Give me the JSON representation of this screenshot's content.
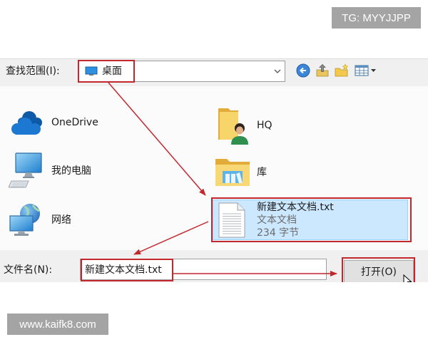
{
  "watermarks": {
    "top_right": "TG: MYYJJPP",
    "bottom_left": "www.kaifk8.com"
  },
  "dialog": {
    "look_in": {
      "label": "查找范围(I):",
      "value": "桌面",
      "icon": "desktop-icon",
      "dropdown_icon": "chevron-down-icon"
    },
    "toolbar": {
      "back": "back-icon",
      "up": "up-one-level-icon",
      "new_folder": "new-folder-icon",
      "view": "view-menu-icon"
    },
    "locations": [
      {
        "label": "OneDrive",
        "icon": "onedrive-cloud-icon"
      },
      {
        "label": "我的电脑",
        "icon": "computer-icon"
      },
      {
        "label": "网络",
        "icon": "network-icon"
      },
      {
        "label": "HQ",
        "icon": "user-folder-icon"
      },
      {
        "label": "库",
        "icon": "library-icon"
      }
    ],
    "selected_file": {
      "name": "新建文本文档.txt",
      "type": "文本文档",
      "size": "234 字节",
      "icon": "text-file-icon"
    },
    "file_name": {
      "label": "文件名(N):",
      "value": "新建文本文档.txt"
    },
    "open_button": {
      "label": "打开(O)"
    }
  },
  "colors": {
    "annotation_red": "#c1272d",
    "selection_bg": "#cce8ff",
    "selection_border": "#99d1ff",
    "watermark_bg": "#a4a4a4"
  }
}
